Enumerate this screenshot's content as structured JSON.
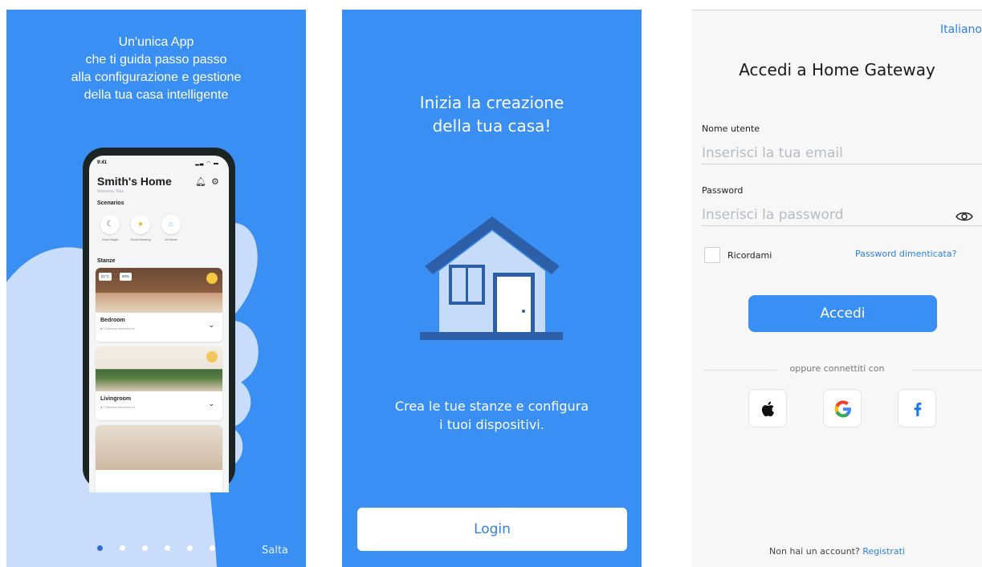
{
  "screen1": {
    "headline": [
      "Un'unica App",
      "che ti guida passo passo",
      "alla configurazione e gestione",
      "della tua casa intelligente"
    ],
    "phone": {
      "time": "9:41",
      "title": "Smith's Home",
      "welcome": "Welcome, Max",
      "scenarios_label": "Scenarios",
      "scenarios": [
        {
          "icon": "moon-icon",
          "label": "Good Night"
        },
        {
          "icon": "sun-icon",
          "label": "Good Morning"
        },
        {
          "icon": "home-icon",
          "label": "At Home"
        }
      ],
      "rooms_label": "Stanze",
      "rooms": [
        {
          "name": "Bedroom",
          "status": "3 Devices switched on",
          "temp": "21°C",
          "humidity": "60%"
        },
        {
          "name": "Livingroom",
          "status": "2 Devices switched on"
        }
      ]
    },
    "pagination": {
      "count": 6,
      "active": 0
    },
    "skip_label": "Salta"
  },
  "screen2": {
    "title": [
      "Inizia la creazione",
      "della tua casa!"
    ],
    "subtitle": [
      "Crea le tue stanze e configura",
      "i tuoi dispositivi."
    ],
    "login_label": "Login"
  },
  "screen3": {
    "language": "Italiano",
    "title": "Accedi a Home Gateway",
    "username_label": "Nome utente",
    "username_placeholder": "Inserisci la tua email",
    "password_label": "Password",
    "password_placeholder": "Inserisci la password",
    "remember_label": "Ricordami",
    "forgot_label": "Password dimenticata?",
    "submit_label": "Accedi",
    "or_label": "oppure connettiti con",
    "social": [
      "apple-icon",
      "google-icon",
      "facebook-icon"
    ],
    "signup_prompt": "Non hai un account?",
    "signup_link": "Registrati"
  },
  "colors": {
    "brand_blue": "#3a8ff5",
    "hand": "#c9dcfb",
    "house_dark": "#2d5fa8",
    "house_light": "#c6dbfa",
    "link": "#2e7fe8"
  }
}
